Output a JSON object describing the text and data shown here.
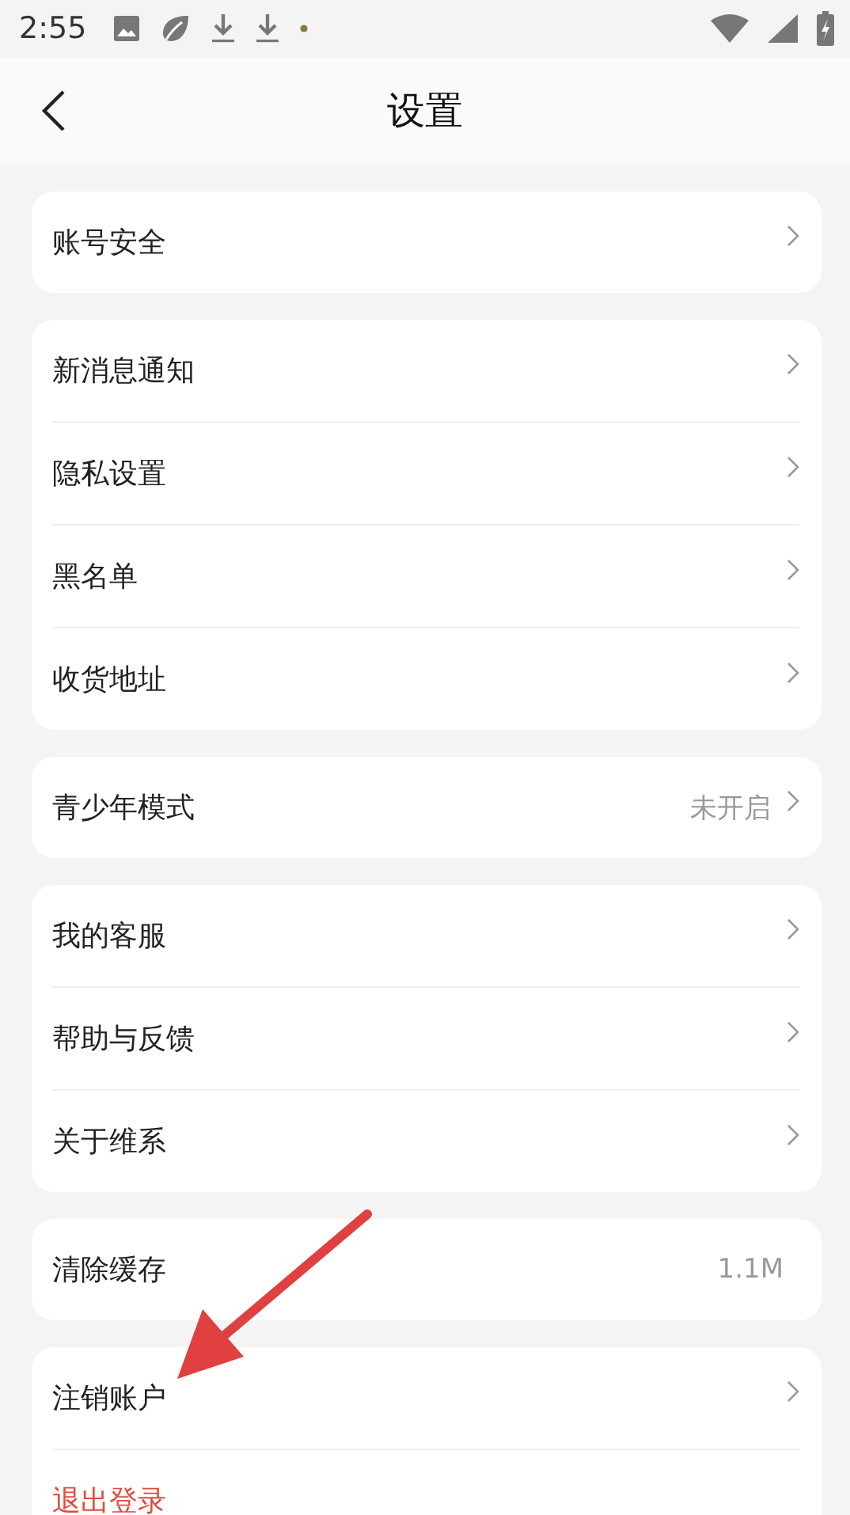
{
  "status_bar": {
    "time": "2:55"
  },
  "header": {
    "title": "设置"
  },
  "groups": [
    {
      "rows": [
        {
          "kind": "nav",
          "label": "账号安全"
        }
      ]
    },
    {
      "rows": [
        {
          "kind": "nav",
          "label": "新消息通知"
        },
        {
          "kind": "nav",
          "label": "隐私设置"
        },
        {
          "kind": "nav",
          "label": "黑名单"
        },
        {
          "kind": "nav",
          "label": "收货地址"
        }
      ]
    },
    {
      "rows": [
        {
          "kind": "nav",
          "label": "青少年模式",
          "value": "未开启"
        }
      ]
    },
    {
      "rows": [
        {
          "kind": "nav",
          "label": "我的客服"
        },
        {
          "kind": "nav",
          "label": "帮助与反馈"
        },
        {
          "kind": "nav",
          "label": "关于维系"
        }
      ]
    },
    {
      "rows": [
        {
          "kind": "value",
          "label": "清除缓存",
          "value": "1.1M"
        }
      ]
    },
    {
      "rows": [
        {
          "kind": "nav",
          "label": "注销账户"
        },
        {
          "kind": "danger",
          "label": "退出登录"
        }
      ]
    }
  ]
}
